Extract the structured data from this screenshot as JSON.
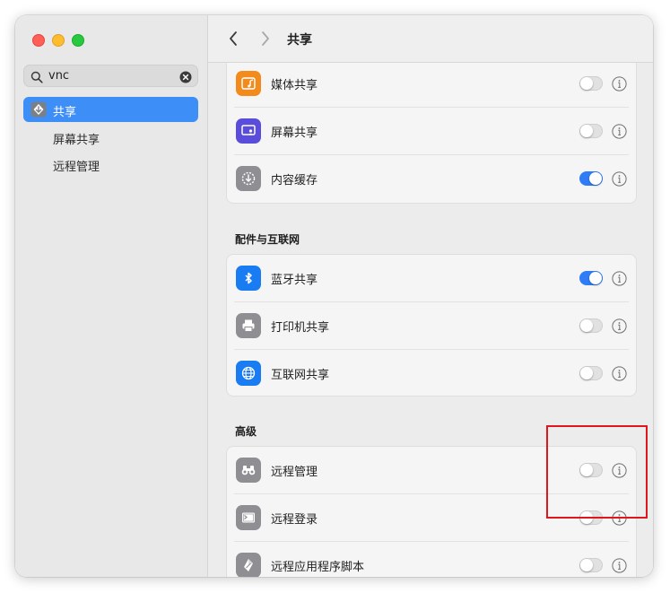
{
  "sidebar": {
    "search_query": "vnc",
    "items": [
      {
        "label": "共享",
        "active": true,
        "icon": "sharing-icon"
      },
      {
        "label": "屏幕共享"
      },
      {
        "label": "远程管理"
      }
    ]
  },
  "header": {
    "title": "共享"
  },
  "groups": [
    {
      "title": "",
      "rows": [
        {
          "label": "媒体共享",
          "icon": "media-sharing-icon",
          "on": false,
          "color": "#f28a1c"
        },
        {
          "label": "屏幕共享",
          "icon": "screen-sharing-icon",
          "on": false,
          "color": "#5b4ddb"
        },
        {
          "label": "内容缓存",
          "icon": "content-cache-icon",
          "on": true,
          "color": "#8e8e93"
        }
      ]
    },
    {
      "title": "配件与互联网",
      "rows": [
        {
          "label": "蓝牙共享",
          "icon": "bluetooth-icon",
          "on": true,
          "color": "#1a7cf2"
        },
        {
          "label": "打印机共享",
          "icon": "printer-icon",
          "on": false,
          "color": "#8e8e93"
        },
        {
          "label": "互联网共享",
          "icon": "globe-icon",
          "on": false,
          "color": "#1a7cf2"
        }
      ]
    },
    {
      "title": "高级",
      "rows": [
        {
          "label": "远程管理",
          "icon": "binoculars-icon",
          "on": false,
          "color": "#8e8e93"
        },
        {
          "label": "远程登录",
          "icon": "terminal-icon",
          "on": false,
          "color": "#8e8e93"
        },
        {
          "label": "远程应用程序脚本",
          "icon": "script-icon",
          "on": false,
          "color": "#8e8e93"
        }
      ]
    }
  ],
  "colors": {
    "accent": "#2f7cf6",
    "highlight_box": "#e0161b"
  }
}
